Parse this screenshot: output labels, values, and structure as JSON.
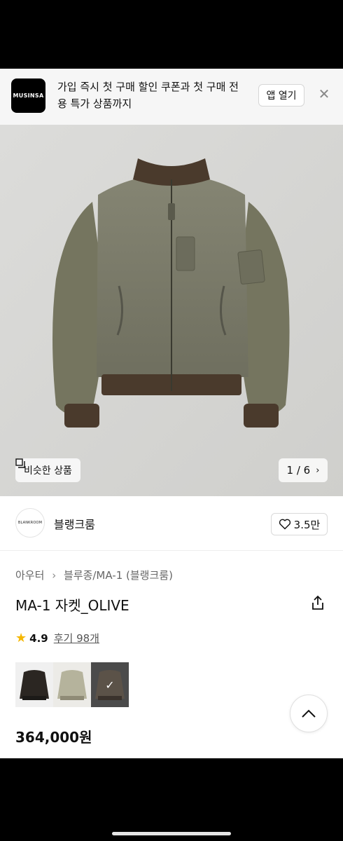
{
  "banner": {
    "logo_text": "MUSINSA",
    "message": "가입 즉시 첫 구매 할인 쿠폰과 첫 구매 전용 특가 상품까지",
    "open_app_label": "앱 열기",
    "close_icon": "close-icon"
  },
  "hero": {
    "similar_label": "비슷한 상품",
    "similar_icon": "similar-items-icon",
    "pager_text": "1 / 6",
    "pager_icon": "chevron-right-icon"
  },
  "brand": {
    "logo_text": "BLANKROOM",
    "name": "블랭크룸",
    "like_count": "3.5만",
    "like_icon": "heart-icon"
  },
  "product": {
    "breadcrumb": [
      "아우터",
      "블루종/MA-1 (블랭크룸)"
    ],
    "title": "MA-1 자켓_OLIVE",
    "share_icon": "share-icon",
    "rating": "4.9",
    "reviews": "후기 98개",
    "price": "364,000원"
  },
  "colors": {
    "accent_star": "#f5b700",
    "jacket_olive": "#7a7a68",
    "rib_brown": "#4a3a2c"
  }
}
